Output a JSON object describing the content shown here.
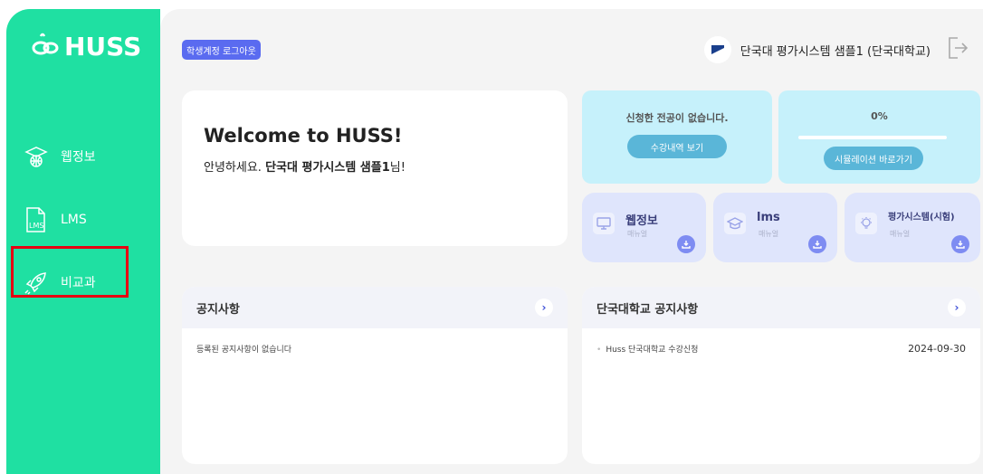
{
  "brand": {
    "name": "HUSS"
  },
  "sidebar": {
    "items": [
      {
        "label": "웹정보"
      },
      {
        "label": "LMS"
      },
      {
        "label": "비교과"
      }
    ]
  },
  "header": {
    "logout_label": "학생계정 로그아웃",
    "user_name": "단국대 평가시스템 샘플1 (단국대학교)"
  },
  "welcome": {
    "title": "Welcome to HUSS!",
    "greeting_prefix": "안녕하세요. ",
    "greeting_name": "단국대 평가시스템 샘플1",
    "greeting_suffix": "님!"
  },
  "major_card": {
    "title": "신청한 전공이 없습니다.",
    "button": "수강내역 보기"
  },
  "simulation_card": {
    "percent_label": "0%",
    "progress": 0,
    "button": "시뮬레이션 바로가기"
  },
  "manuals": [
    {
      "title": "웹정보",
      "sub": "매뉴얼"
    },
    {
      "title": "lms",
      "sub": "매뉴얼"
    },
    {
      "title": "평가시스템(시험)",
      "sub": "매뉴얼"
    }
  ],
  "notices": {
    "title": "공지사항",
    "empty": "등록된 공지사항이 없습니다"
  },
  "school_notices": {
    "title": "단국대학교 공지사항",
    "items": [
      {
        "text": "Huss 단국대학교 수강신청",
        "date": "2024-09-30"
      }
    ]
  },
  "colors": {
    "sidebar": "#1fe0a2",
    "accent": "#5a6bf0",
    "highlight": "#e60012"
  }
}
